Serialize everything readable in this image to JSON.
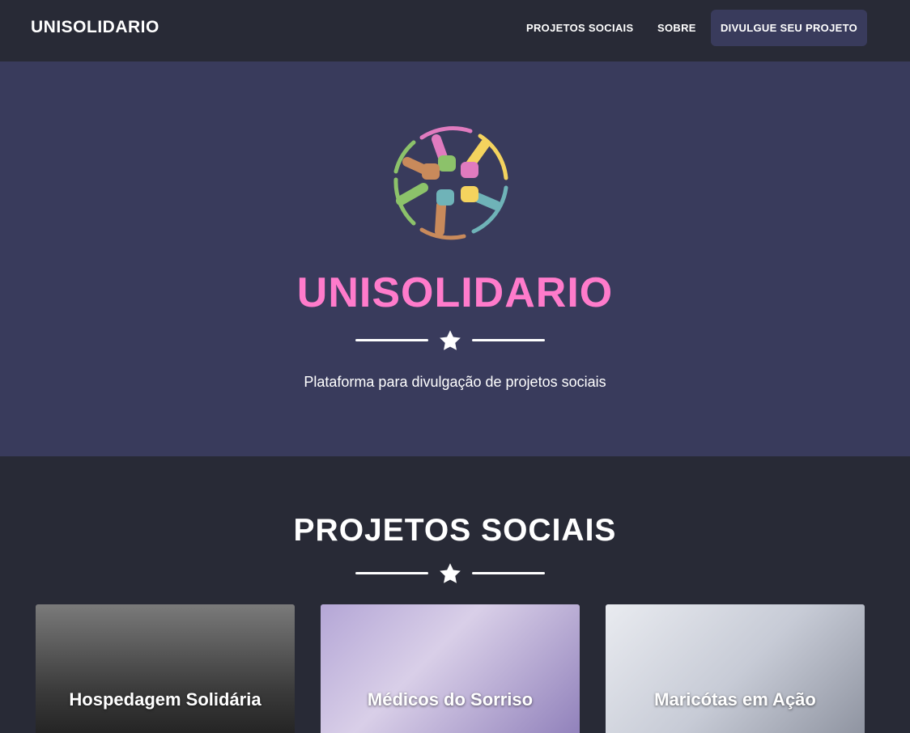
{
  "nav": {
    "brand": "UNISOLIDARIO",
    "links": [
      "PROJETOS SOCIAIS",
      "SOBRE"
    ],
    "cta": "DIVULGUE SEU PROJETO"
  },
  "hero": {
    "title": "UNISOLIDARIO",
    "subtitle": "Plataforma para divulgação de projetos sociais",
    "title_color": "#ff7bcb",
    "background": "#393b5c"
  },
  "projects": {
    "title": "PROJETOS SOCIAIS",
    "items": [
      {
        "title": "Hospedagem Solidária"
      },
      {
        "title": "Médicos do Sorriso"
      },
      {
        "title": "Maricótas em Ação"
      }
    ]
  },
  "colors": {
    "navbar": "#282a36",
    "accent_button": "#393b5c",
    "section_background": "#282a36"
  },
  "icons": {
    "logo": "hands-circle-logo-icon",
    "divider": "star-icon"
  }
}
